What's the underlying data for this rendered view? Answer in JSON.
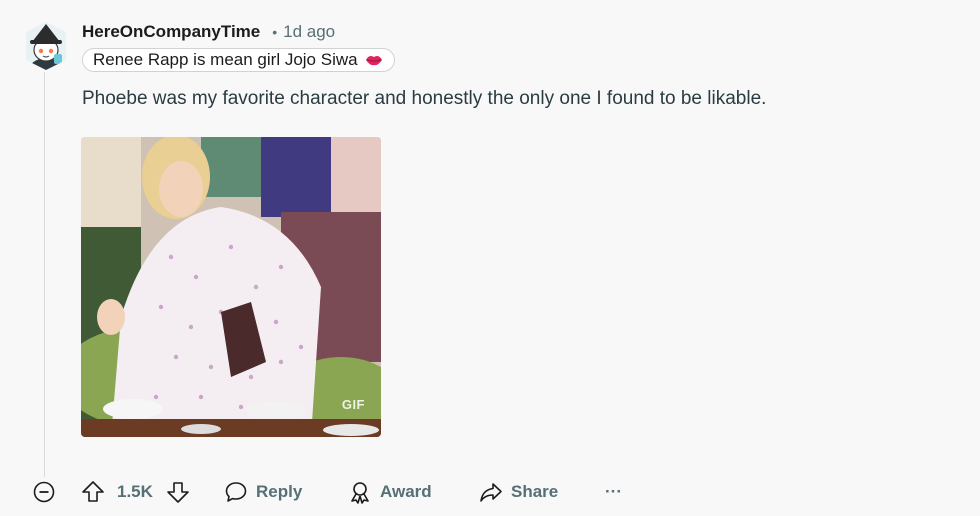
{
  "comment": {
    "username": "HereOnCompanyTime",
    "separator": "•",
    "time": "1d ago",
    "flair_text": "Renee Rapp is mean girl Jojo Siwa",
    "body": "Phoebe was my favorite character and honestly the only one I found to be likable.",
    "media": {
      "badge": "GIF"
    }
  },
  "actions": {
    "score": "1.5K",
    "reply_label": "Reply",
    "award_label": "Award",
    "share_label": "Share",
    "more_label": "···"
  },
  "icons": {
    "avatar": "snoo-avatar-icon",
    "flair_emoji": "lips-icon",
    "collapse": "collapse-minus-icon",
    "upvote": "upvote-arrow-icon",
    "downvote": "downvote-arrow-icon",
    "reply": "speech-bubble-icon",
    "award": "award-ribbon-icon",
    "share": "share-arrow-icon"
  },
  "colors": {
    "background": "#f8f8f8",
    "muted_text": "#576f76",
    "flair_emoji": "#e0245e"
  }
}
